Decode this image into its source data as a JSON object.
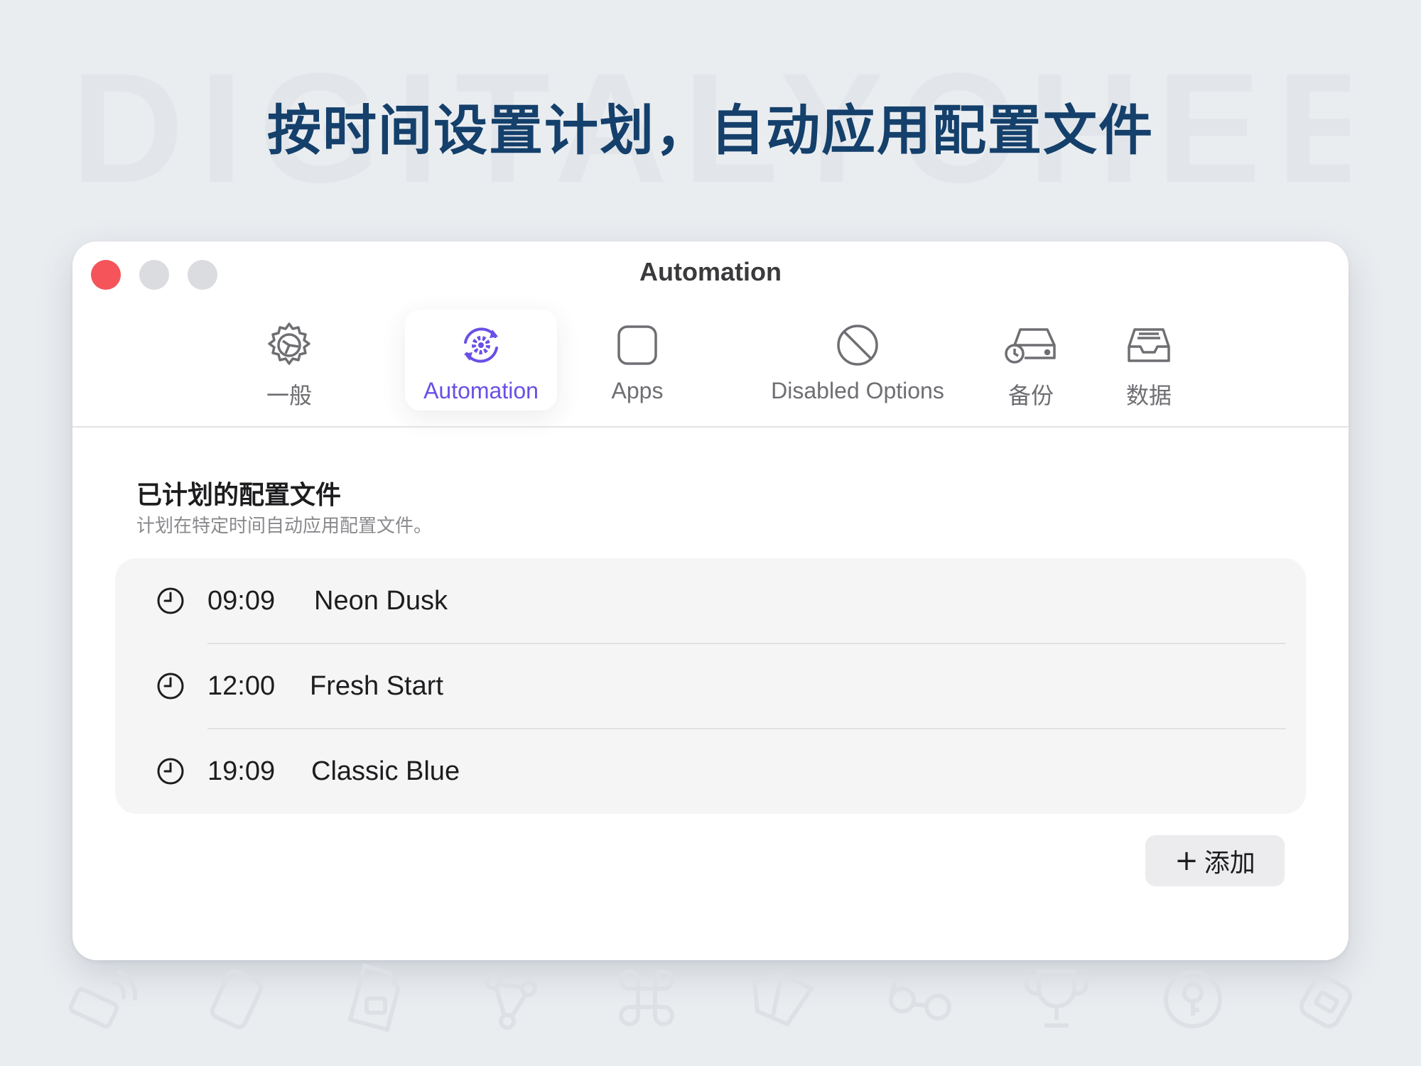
{
  "watermark": "DIGITALYCHEE",
  "headline": "按时间设置计划，自动应用配置文件",
  "window": {
    "title": "Automation",
    "traffic_lights": [
      "close",
      "minimize",
      "zoom"
    ]
  },
  "toolbar": {
    "tabs": [
      {
        "label": "一般",
        "icon": "gear-icon",
        "active": false
      },
      {
        "label": "Automation",
        "icon": "automation-cycle-icon",
        "active": true
      },
      {
        "label": "Apps",
        "icon": "rounded-square-icon",
        "active": false
      },
      {
        "label": "Disabled Options",
        "icon": "prohibited-icon",
        "active": false
      },
      {
        "label": "备份",
        "icon": "drive-restore-icon",
        "active": false
      },
      {
        "label": "数据",
        "icon": "tray-icon",
        "active": false
      }
    ]
  },
  "section": {
    "title": "已计划的配置文件",
    "subtitle": "计划在特定时间自动应用配置文件。"
  },
  "schedules": [
    {
      "time": "09:09",
      "name": "Neon Dusk",
      "icon": "clock-icon"
    },
    {
      "time": "12:00",
      "name": "Fresh Start",
      "icon": "clock-icon"
    },
    {
      "time": "19:09",
      "name": "Classic Blue",
      "icon": "clock-icon"
    }
  ],
  "add_button": {
    "icon": "plus-icon",
    "label": "添加"
  },
  "colors": {
    "accent": "#6a4fe6",
    "headline": "#14406b",
    "close_light": "#f4545a",
    "background": "#eaedf0"
  },
  "background_icons": [
    "wireless-icon",
    "usb-drive-icon",
    "secure-file-icon",
    "network-nodes-icon",
    "command-key-icon",
    "book-icon",
    "glasses-icon",
    "trophy-icon",
    "key-icon",
    "tag-icon"
  ]
}
